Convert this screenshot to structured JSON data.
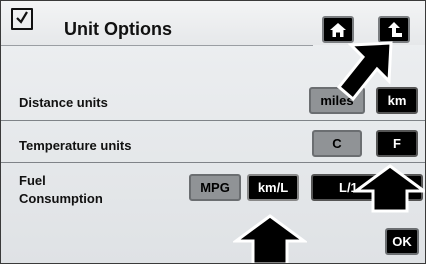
{
  "header": {
    "title": "Unit Options",
    "checkbox_icon": "checkbox-checked-icon",
    "home_icon": "home-icon",
    "back_icon": "back-arrow-icon"
  },
  "rows": {
    "distance": {
      "label": "Distance units",
      "options": [
        "miles",
        "km"
      ],
      "selected": "miles"
    },
    "temperature": {
      "label": "Temperature units",
      "options": [
        "C",
        "F"
      ],
      "selected": "C"
    },
    "fuel": {
      "label_line1": "Fuel",
      "label_line2": "Consumption",
      "options": [
        "MPG",
        "km/L",
        "L/1"
      ],
      "selected": "MPG"
    }
  },
  "ok_label": "OK",
  "colors": {
    "selected_bg": "#909396",
    "unselected_bg": "#000000",
    "background": "#e6e8ea"
  }
}
